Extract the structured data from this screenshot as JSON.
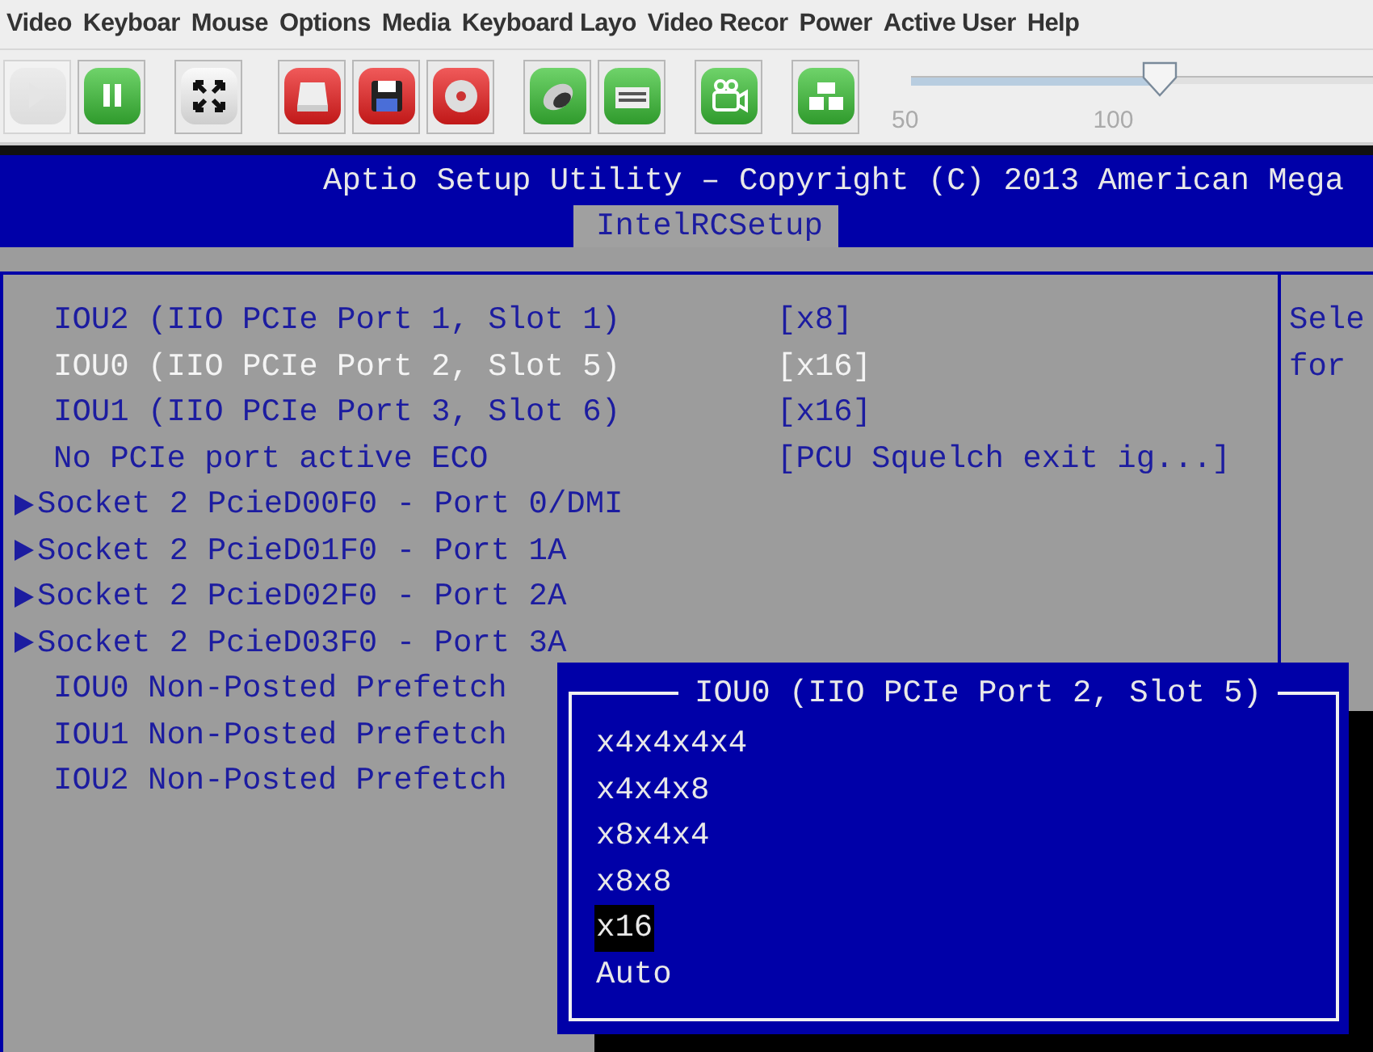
{
  "menu_bar": {
    "items": [
      "Video",
      "Keyboar",
      "Mouse",
      "Options",
      "Media",
      "Keyboard Layo",
      "Video Recor",
      "Power",
      "Active User",
      "Help"
    ]
  },
  "toolbar": {
    "buttons": [
      {
        "kind": "play",
        "disabled": true
      },
      {
        "kind": "pause",
        "disabled": false
      },
      {
        "kind": "fullscreen",
        "disabled": false
      },
      {
        "kind": "drive",
        "disabled": false
      },
      {
        "kind": "floppy",
        "disabled": false
      },
      {
        "kind": "cd",
        "disabled": false
      },
      {
        "kind": "mouse",
        "disabled": false
      },
      {
        "kind": "keyboard",
        "disabled": false
      },
      {
        "kind": "camera",
        "disabled": false
      },
      {
        "kind": "blocks",
        "disabled": false
      }
    ],
    "slider": {
      "level": 0.54,
      "ticks": [
        "50",
        "100"
      ]
    }
  },
  "bios": {
    "title": "Aptio Setup Utility – Copyright (C) 2013 American Mega",
    "tabs": [
      {
        "label": "IntelRCSetup",
        "selected": true
      }
    ],
    "items": [
      {
        "kind": "setting",
        "label": "IOU2 (IIO PCIe Port 1, Slot 1)",
        "value": "[x8]",
        "selected": false
      },
      {
        "kind": "setting",
        "label": "IOU0 (IIO PCIe Port 2, Slot 5)",
        "value": "[x16]",
        "selected": true
      },
      {
        "kind": "setting",
        "label": "IOU1 (IIO PCIe Port 3, Slot 6)",
        "value": "[x16]",
        "selected": false
      },
      {
        "kind": "setting",
        "label": "No PCIe port active ECO",
        "value": "[PCU Squelch exit ig...]",
        "selected": false
      },
      {
        "kind": "submenu",
        "label": "Socket 2 PcieD00F0 - Port 0/DMI",
        "selected": false
      },
      {
        "kind": "submenu",
        "label": "Socket 2 PcieD01F0 - Port 1A",
        "selected": false
      },
      {
        "kind": "submenu",
        "label": "Socket 2 PcieD02F0 - Port 2A",
        "selected": false
      },
      {
        "kind": "submenu",
        "label": "Socket 2 PcieD03F0 - Port 3A",
        "selected": false
      },
      {
        "kind": "setting",
        "label": "IOU0 Non-Posted Prefetch",
        "selected": false
      },
      {
        "kind": "setting",
        "label": "IOU1 Non-Posted Prefetch",
        "selected": false
      },
      {
        "kind": "setting",
        "label": "IOU2 Non-Posted Prefetch",
        "selected": false
      }
    ],
    "help_lines": [
      "Sele",
      "for"
    ]
  },
  "popup": {
    "title": "IOU0 (IIO PCIe Port 2, Slot 5)",
    "options": [
      {
        "label": "x4x4x4x4",
        "selected": false
      },
      {
        "label": "x4x4x8",
        "selected": false
      },
      {
        "label": "x8x4x4",
        "selected": false
      },
      {
        "label": "x8x8",
        "selected": false
      },
      {
        "label": "x16",
        "selected": true
      },
      {
        "label": "Auto",
        "selected": false
      }
    ]
  }
}
